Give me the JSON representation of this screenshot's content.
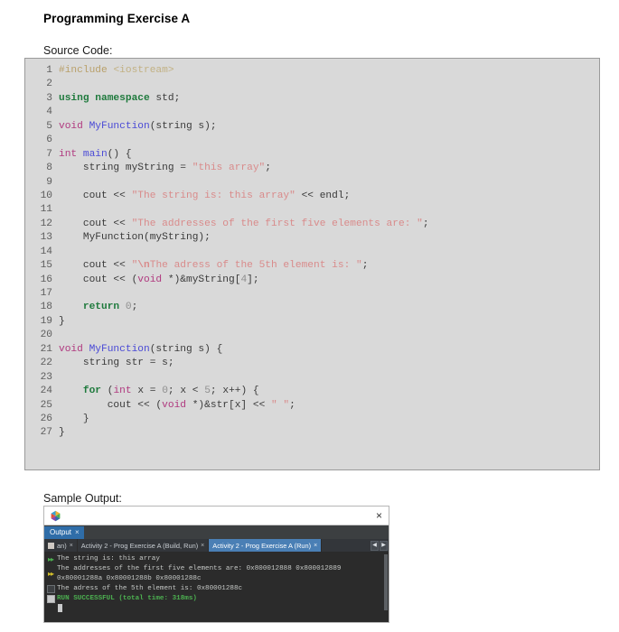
{
  "page_title": "Programming Exercise A",
  "sections": {
    "source_label": "Source Code:",
    "output_label": "Sample Output:"
  },
  "code": {
    "language": "cpp",
    "lines": [
      {
        "n": "1",
        "tokens": [
          {
            "t": "#include ",
            "c": "k-pre"
          },
          {
            "t": "<iostream>",
            "c": "k-inc"
          }
        ]
      },
      {
        "n": "2",
        "tokens": []
      },
      {
        "n": "3",
        "tokens": [
          {
            "t": "using namespace",
            "c": "k-kw"
          },
          {
            "t": " std;",
            "c": "k-plain"
          }
        ]
      },
      {
        "n": "4",
        "tokens": []
      },
      {
        "n": "5",
        "tokens": [
          {
            "t": "void ",
            "c": "k-type"
          },
          {
            "t": "MyFunction",
            "c": "k-fn"
          },
          {
            "t": "(string s);",
            "c": "k-plain"
          }
        ]
      },
      {
        "n": "6",
        "tokens": []
      },
      {
        "n": "7",
        "tokens": [
          {
            "t": "int ",
            "c": "k-type"
          },
          {
            "t": "main",
            "c": "k-fn"
          },
          {
            "t": "() {",
            "c": "k-plain"
          }
        ]
      },
      {
        "n": "8",
        "tokens": [
          {
            "t": "    string myString = ",
            "c": "k-plain"
          },
          {
            "t": "\"this array\"",
            "c": "k-str"
          },
          {
            "t": ";",
            "c": "k-plain"
          }
        ]
      },
      {
        "n": "9",
        "tokens": []
      },
      {
        "n": "10",
        "tokens": [
          {
            "t": "    cout << ",
            "c": "k-plain"
          },
          {
            "t": "\"The string is: this array\"",
            "c": "k-str"
          },
          {
            "t": " << endl;",
            "c": "k-plain"
          }
        ]
      },
      {
        "n": "11",
        "tokens": []
      },
      {
        "n": "12",
        "tokens": [
          {
            "t": "    cout << ",
            "c": "k-plain"
          },
          {
            "t": "\"The addresses of the first five elements are: \"",
            "c": "k-str"
          },
          {
            "t": ";",
            "c": "k-plain"
          }
        ]
      },
      {
        "n": "13",
        "tokens": [
          {
            "t": "    MyFunction(myString);",
            "c": "k-plain"
          }
        ]
      },
      {
        "n": "14",
        "tokens": []
      },
      {
        "n": "15",
        "tokens": [
          {
            "t": "    cout << ",
            "c": "k-plain"
          },
          {
            "t": "\"",
            "c": "k-str"
          },
          {
            "t": "\\n",
            "c": "k-strb"
          },
          {
            "t": "The adress of the 5th element is: \"",
            "c": "k-str"
          },
          {
            "t": ";",
            "c": "k-plain"
          }
        ]
      },
      {
        "n": "16",
        "tokens": [
          {
            "t": "    cout << (",
            "c": "k-plain"
          },
          {
            "t": "void ",
            "c": "k-type"
          },
          {
            "t": "*)&myString[",
            "c": "k-plain"
          },
          {
            "t": "4",
            "c": "k-num"
          },
          {
            "t": "];",
            "c": "k-plain"
          }
        ]
      },
      {
        "n": "17",
        "tokens": []
      },
      {
        "n": "18",
        "tokens": [
          {
            "t": "    ",
            "c": "k-plain"
          },
          {
            "t": "return",
            "c": "k-kw"
          },
          {
            "t": " ",
            "c": "k-plain"
          },
          {
            "t": "0",
            "c": "k-num"
          },
          {
            "t": ";",
            "c": "k-plain"
          }
        ]
      },
      {
        "n": "19",
        "tokens": [
          {
            "t": "}",
            "c": "k-plain"
          }
        ]
      },
      {
        "n": "20",
        "tokens": []
      },
      {
        "n": "21",
        "tokens": [
          {
            "t": "void ",
            "c": "k-type"
          },
          {
            "t": "MyFunction",
            "c": "k-fn"
          },
          {
            "t": "(string s) {",
            "c": "k-plain"
          }
        ]
      },
      {
        "n": "22",
        "tokens": [
          {
            "t": "    string str = s;",
            "c": "k-plain"
          }
        ]
      },
      {
        "n": "23",
        "tokens": []
      },
      {
        "n": "24",
        "tokens": [
          {
            "t": "    ",
            "c": "k-plain"
          },
          {
            "t": "for",
            "c": "k-kw"
          },
          {
            "t": " (",
            "c": "k-plain"
          },
          {
            "t": "int",
            "c": "k-type"
          },
          {
            "t": " x = ",
            "c": "k-plain"
          },
          {
            "t": "0",
            "c": "k-num"
          },
          {
            "t": "; x < ",
            "c": "k-plain"
          },
          {
            "t": "5",
            "c": "k-num"
          },
          {
            "t": "; x++) {",
            "c": "k-plain"
          }
        ]
      },
      {
        "n": "25",
        "tokens": [
          {
            "t": "        cout << (",
            "c": "k-plain"
          },
          {
            "t": "void ",
            "c": "k-type"
          },
          {
            "t": "*)&str[x] << ",
            "c": "k-plain"
          },
          {
            "t": "\" \"",
            "c": "k-str"
          },
          {
            "t": ";",
            "c": "k-plain"
          }
        ]
      },
      {
        "n": "26",
        "tokens": [
          {
            "t": "    }",
            "c": "k-plain"
          }
        ]
      },
      {
        "n": "27",
        "tokens": [
          {
            "t": "}",
            "c": "k-plain"
          }
        ]
      }
    ]
  },
  "output_window": {
    "titlebar": {
      "logo_icon": "netbeans-logo-icon",
      "close_icon": "×"
    },
    "main_tab": {
      "label": "Output",
      "close_icon": "×"
    },
    "sub_tabs": [
      {
        "label": "an)",
        "close_icon": "×",
        "selected": false,
        "has_icon": true
      },
      {
        "label": "Activity 2 - Prog Exercise A (Build, Run)",
        "close_icon": "×",
        "selected": false,
        "has_icon": false
      },
      {
        "label": "Activity 2 - Prog Exercise A (Run)",
        "close_icon": "×",
        "selected": true,
        "has_icon": false
      }
    ],
    "tab_scroll": {
      "left_arrow": "◀",
      "right_arrow": "▶"
    },
    "console_lines": [
      {
        "text": "The string is: this array",
        "color": "default",
        "gutter": "chev-green"
      },
      {
        "text": "The addresses of the first five elements are: 0x800012888 0x800012889",
        "color": "default",
        "gutter": "chev-yellow"
      },
      {
        "text": "0x80001288a 0x80001288b 0x80001288c",
        "color": "default",
        "gutter": "none"
      },
      {
        "text": "The adress of the 5th element is: 0x80001288c",
        "color": "default",
        "gutter": "terminal-square"
      },
      {
        "text": "RUN SUCCESSFUL (total time: 318ms)",
        "color": "green",
        "gutter": "light-square"
      }
    ]
  },
  "colors": {
    "code_bg": "#d9d9d9",
    "console_bg": "#2b2b2b",
    "tab_selected": "#4a7fb5",
    "success_green": "#4caf50",
    "string_literal": "#d98b8b",
    "keyword_green": "#1f7a3d",
    "type_magenta": "#b0397f",
    "function_blue": "#4a4ad6"
  }
}
